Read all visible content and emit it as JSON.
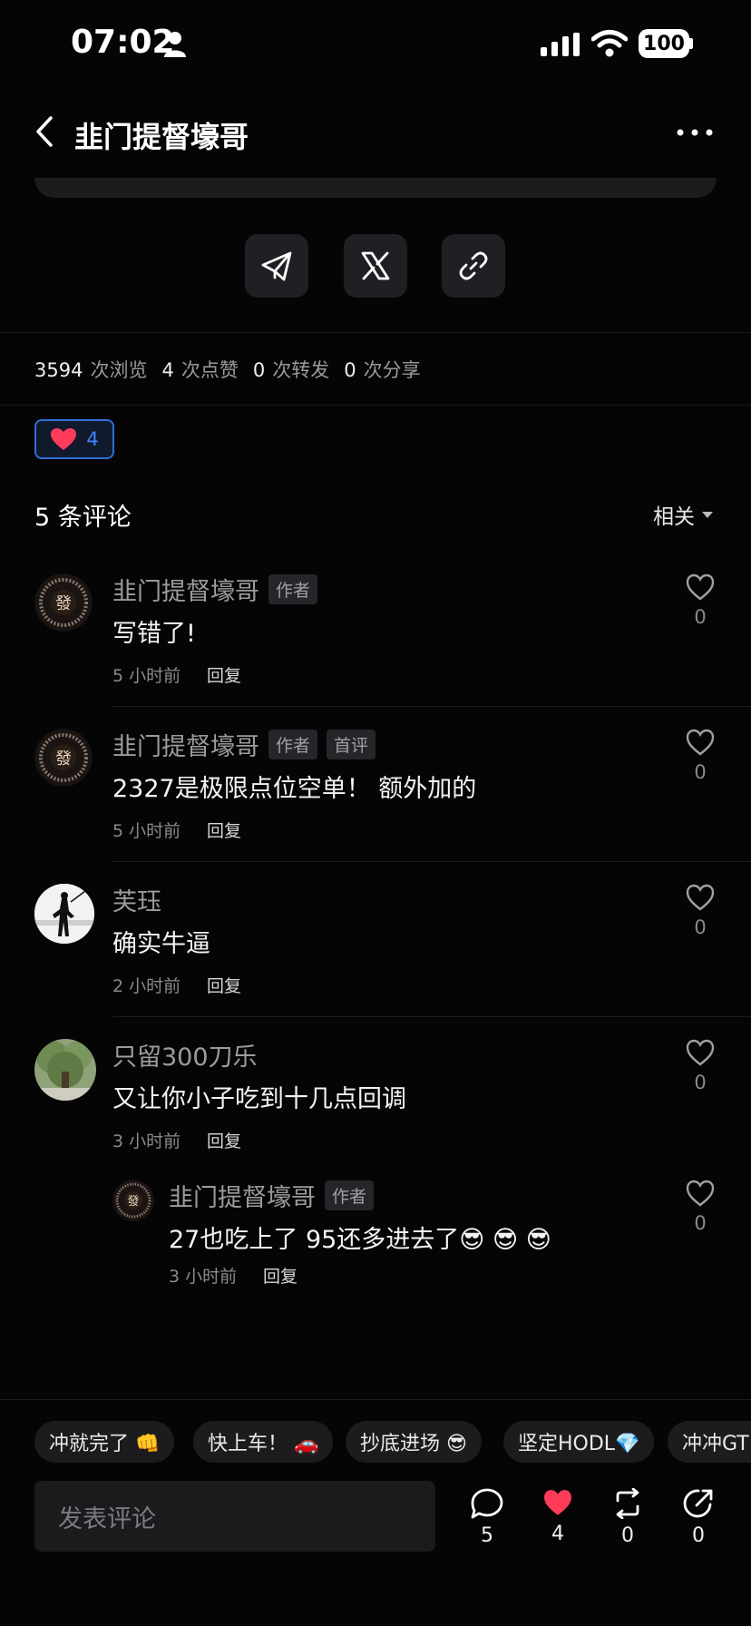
{
  "status_bar": {
    "time": "07:02",
    "battery": "100"
  },
  "header": {
    "title": "韭门提督壕哥"
  },
  "stats": [
    {
      "num": "3594",
      "label": "次浏览"
    },
    {
      "num": "4",
      "label": "次点赞"
    },
    {
      "num": "0",
      "label": "次转发"
    },
    {
      "num": "0",
      "label": "次分享"
    }
  ],
  "like_chip": {
    "count": "4"
  },
  "comments_header": {
    "title": "5 条评论",
    "sort": "相关"
  },
  "comments": [
    {
      "name": "韭门提督壕哥",
      "tags": [
        "作者"
      ],
      "text": "写错了!",
      "time": "5 小时前",
      "reply": "回复",
      "likes": "0"
    },
    {
      "name": "韭门提督壕哥",
      "tags": [
        "作者",
        "首评"
      ],
      "text": "2327是极限点位空单！ 额外加的",
      "time": "5 小时前",
      "reply": "回复",
      "likes": "0"
    },
    {
      "name": "芙珏",
      "tags": [],
      "text": "确实牛逼",
      "time": "2 小时前",
      "reply": "回复",
      "likes": "0"
    },
    {
      "name": "只留300刀乐",
      "tags": [],
      "text": "又让你小子吃到十几点回调",
      "time": "3 小时前",
      "reply": "回复",
      "likes": "0"
    }
  ],
  "reply_comment": {
    "name": "韭门提督壕哥",
    "tag": "作者",
    "text": "27也吃上了 95还多进去了😎 😎 😎",
    "time": "3 小时前",
    "reply": "回复",
    "likes": "0"
  },
  "quick_replies": [
    "冲就完了 👊",
    "快上车！ 🚗",
    "抄底进场 😎",
    "坚定HODL💎",
    "冲冲GT"
  ],
  "composer": {
    "placeholder": "发表评论"
  },
  "actions": {
    "comments": "5",
    "likes": "4",
    "reposts": "0",
    "shares": "0"
  },
  "colors": {
    "accent_blue": "#2f6fd6",
    "heart_red": "#ff3b5c",
    "background": "#050506"
  }
}
